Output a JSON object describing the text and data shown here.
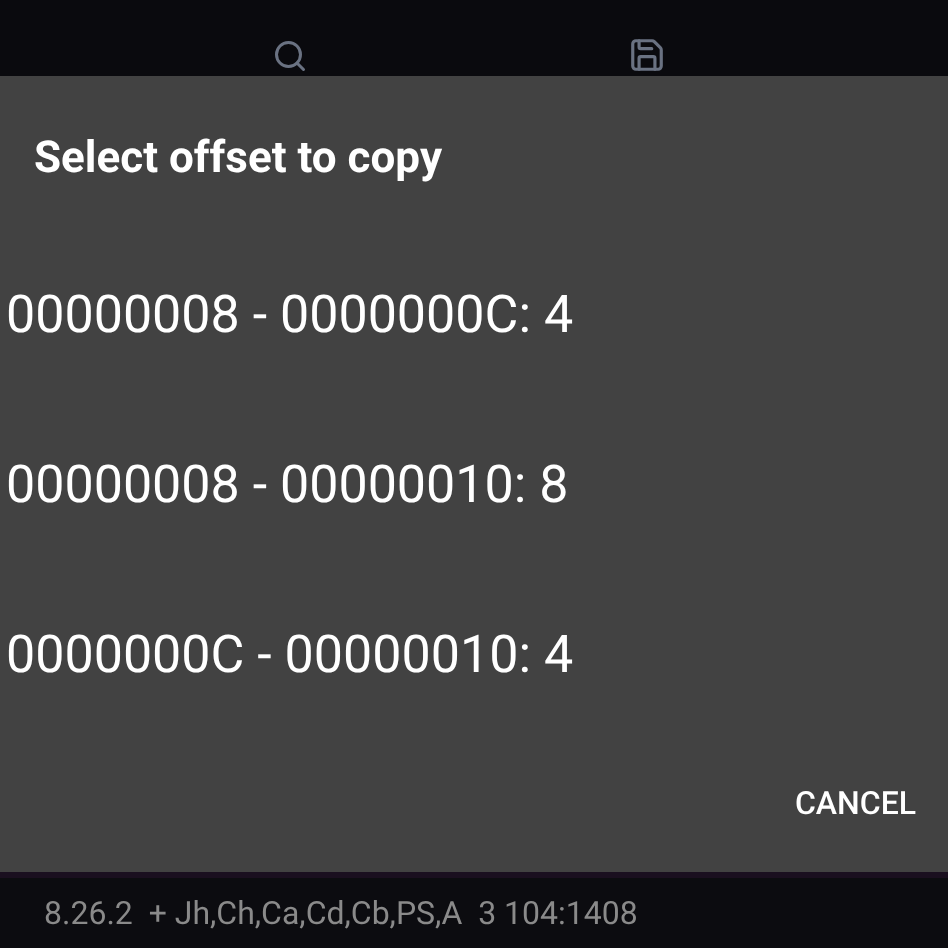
{
  "dialog": {
    "title": "Select offset to copy",
    "options": [
      {
        "label": "00000008 - 0000000C: 4"
      },
      {
        "label": "00000008 - 00000010: 8"
      },
      {
        "label": "0000000C - 00000010: 4"
      }
    ],
    "buttons": [
      "CANCEL"
    ]
  },
  "status_bar": {
    "text": "8.26.2  + Jh,Ch,Ca,Cd,Cb,PS,A  3 104:1408"
  }
}
